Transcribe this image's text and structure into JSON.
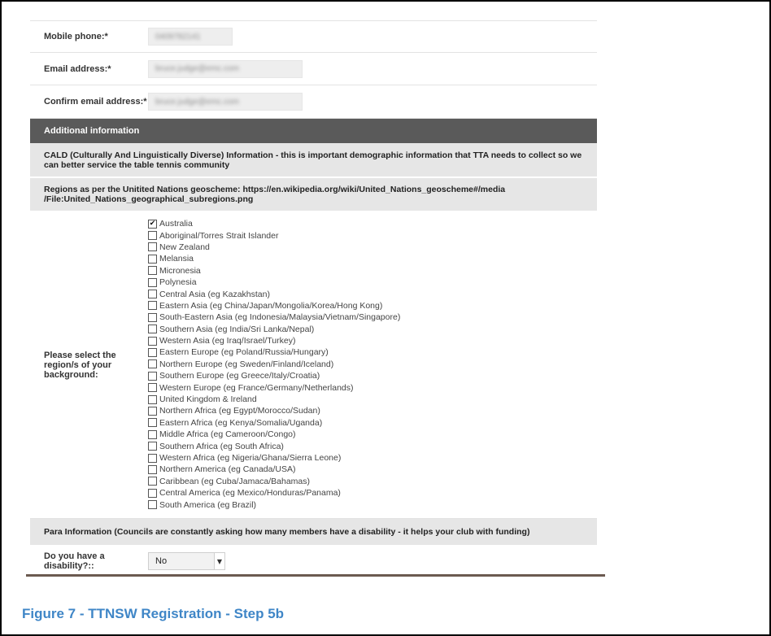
{
  "contact": {
    "mobile_label": "Mobile phone:*",
    "mobile_value": "0409782141",
    "email_label": "Email address:*",
    "email_value": "bruce.judge@emc.com",
    "confirm_email_label": "Confirm email address:*",
    "confirm_email_value": "bruce.judge@emc.com"
  },
  "additional": {
    "header": "Additional information",
    "cald_text": "CALD (Culturally And Linguistically Diverse) Information - this is important demographic information that TTA needs to collect so we can better service the table tennis community",
    "regions_text": "Regions as per the Unitited Nations geoscheme: https://en.wikipedia.org/wiki/United_Nations_geoscheme#/media /File:United_Nations_geographical_subregions.png",
    "regions_label": "Please select the region/s of your background:",
    "regions": [
      {
        "label": "Australia",
        "checked": true
      },
      {
        "label": "Aboriginal/Torres Strait Islander",
        "checked": false
      },
      {
        "label": "New Zealand",
        "checked": false
      },
      {
        "label": "Melansia",
        "checked": false
      },
      {
        "label": "Micronesia",
        "checked": false
      },
      {
        "label": "Polynesia",
        "checked": false
      },
      {
        "label": "Central Asia (eg Kazakhstan)",
        "checked": false
      },
      {
        "label": "Eastern Asia (eg China/Japan/Mongolia/Korea/Hong Kong)",
        "checked": false
      },
      {
        "label": "South-Eastern Asia (eg Indonesia/Malaysia/Vietnam/Singapore)",
        "checked": false
      },
      {
        "label": "Southern Asia (eg India/Sri Lanka/Nepal)",
        "checked": false
      },
      {
        "label": "Western Asia (eg Iraq/Israel/Turkey)",
        "checked": false
      },
      {
        "label": "Eastern Europe (eg Poland/Russia/Hungary)",
        "checked": false
      },
      {
        "label": "Northern Europe (eg Sweden/Finland/Iceland)",
        "checked": false
      },
      {
        "label": "Southern Europe (eg Greece/Italy/Croatia)",
        "checked": false
      },
      {
        "label": "Western Europe (eg France/Germany/Netherlands)",
        "checked": false
      },
      {
        "label": "United Kingdom & Ireland",
        "checked": false
      },
      {
        "label": "Northern Africa (eg Egypt/Morocco/Sudan)",
        "checked": false
      },
      {
        "label": "Eastern Africa (eg Kenya/Somalia/Uganda)",
        "checked": false
      },
      {
        "label": "Middle Africa (eg Cameroon/Congo)",
        "checked": false
      },
      {
        "label": "Southern Africa (eg South Africa)",
        "checked": false
      },
      {
        "label": "Western Africa (eg Nigeria/Ghana/Sierra Leone)",
        "checked": false
      },
      {
        "label": "Northern America (eg Canada/USA)",
        "checked": false
      },
      {
        "label": "Caribbean (eg Cuba/Jamaca/Bahamas)",
        "checked": false
      },
      {
        "label": "Central America (eg Mexico/Honduras/Panama)",
        "checked": false
      },
      {
        "label": "South America (eg Brazil)",
        "checked": false
      }
    ]
  },
  "para": {
    "info_text": "Para Information (Councils are constantly asking how many members have a disability - it helps your club with funding)",
    "disability_label": "Do you have a disability?::",
    "disability_value": "No"
  },
  "caption": "Figure 7 - TTNSW Registration - Step 5b",
  "colors": {
    "section_header_bg": "#5a5a5a",
    "info_band_bg": "#e6e6e6",
    "caption_color": "#3f86c7"
  },
  "icons": {
    "checkbox_checked": "check-icon",
    "select_arrow": "chevron-down-icon"
  }
}
